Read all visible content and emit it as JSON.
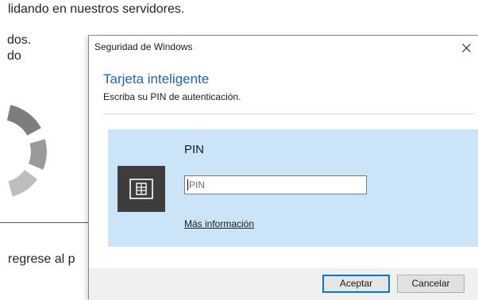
{
  "background": {
    "line1": "lidando en nuestros servidores.",
    "line2": "dos.",
    "line3": "do",
    "line4": "regrese al p",
    "spinner_icon": "loading-spinner-icon"
  },
  "dialog": {
    "title": "Seguridad de Windows",
    "close_icon": "close-icon",
    "heading": "Tarjeta inteligente",
    "subtitle": "Escriba su PIN de autenticación.",
    "tile": {
      "icon": "smart-card-icon",
      "pin_label": "PIN",
      "pin_placeholder": "PIN",
      "pin_value": "",
      "more_info": "Más información"
    },
    "buttons": {
      "accept": "Aceptar",
      "cancel": "Cancelar"
    }
  },
  "colors": {
    "accent": "#0078d7",
    "heading": "#2262b7",
    "tile_background": "#cce4f7",
    "icon_background": "#3d3d3d",
    "footer_background": "#f0f0f0"
  }
}
